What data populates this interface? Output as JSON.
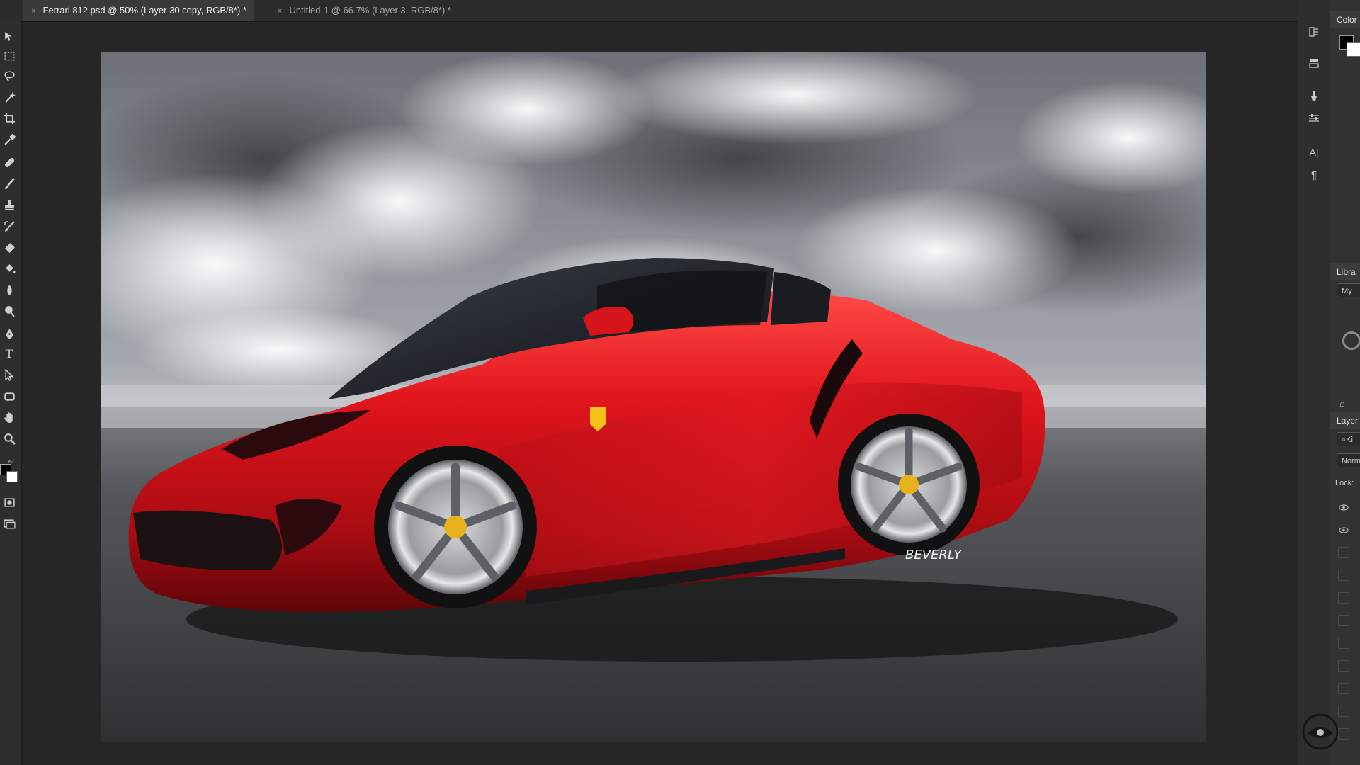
{
  "tabs": [
    {
      "title": "Ferrari 812.psd @ 50% (Layer 30 copy, RGB/8*) *",
      "active": true
    },
    {
      "title": "Untitled-1 @ 66.7% (Layer 3, RGB/8*) *",
      "active": false
    }
  ],
  "tab_close_glyph": "×",
  "collapse_glyph": "«",
  "toolbar": {
    "tools": [
      "move-icon",
      "marquee-icon",
      "lasso-icon",
      "magic-wand-icon",
      "crop-icon",
      "eyedropper-icon",
      "healing-brush-icon",
      "brush-icon",
      "clone-stamp-icon",
      "history-brush-icon",
      "eraser-icon",
      "paint-bucket-icon",
      "blur-icon",
      "dodge-icon",
      "pen-icon",
      "type-icon",
      "path-selection-icon",
      "rectangle-icon",
      "hand-icon",
      "zoom-icon"
    ],
    "type_glyph": "T",
    "foreground_color": "#000000",
    "background_color": "#ffffff"
  },
  "document": {
    "car_color": "#c8141b",
    "sky_color": "#9ea3aa",
    "ground_color": "#3d3e40",
    "signature": "BEVERLY"
  },
  "panel_icons": [
    "history-icon",
    "properties-icon",
    "brush-settings-icon",
    "adjustments-icon",
    "character-icon",
    "paragraph-icon"
  ],
  "character_glyph": "A|",
  "paragraph_glyph": "¶",
  "panels": {
    "color_title": "Color",
    "libraries_title": "Libra",
    "libraries_dropdown": "My",
    "layers_title": "Layer",
    "layers_search": "Ki",
    "blend_mode": "Norm",
    "lock_label": "Lock:"
  }
}
